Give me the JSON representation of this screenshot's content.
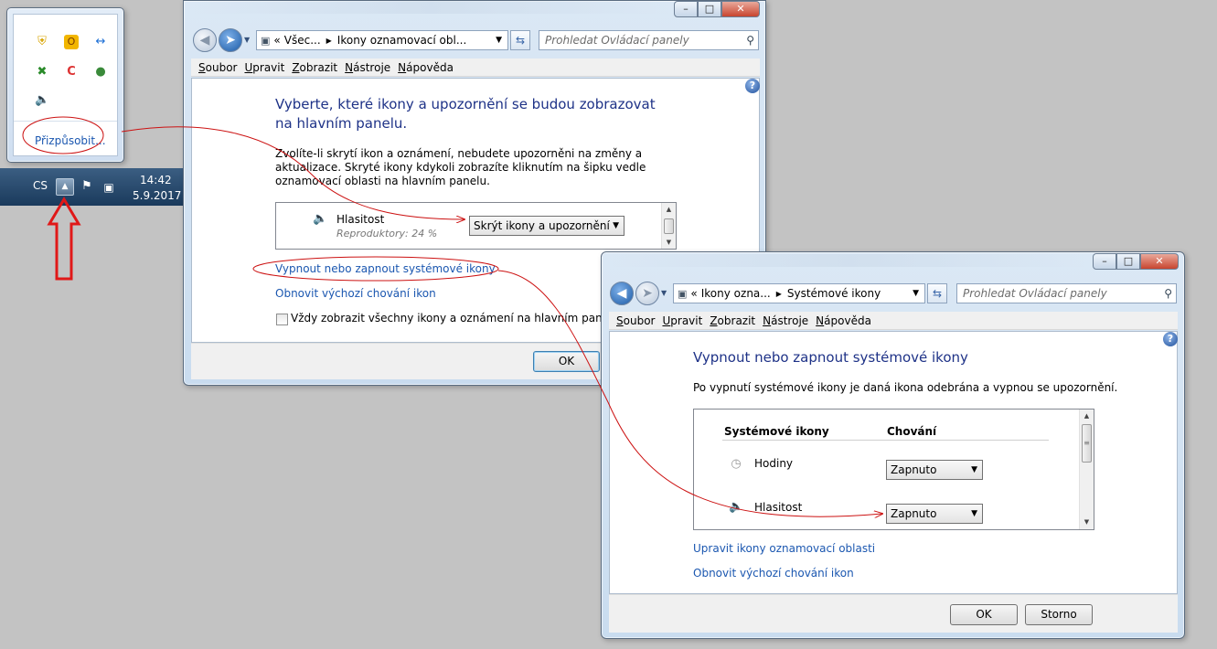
{
  "tray_popup": {
    "customize_link": "Přizpůsobit..."
  },
  "taskbar": {
    "language": "CS",
    "time": "14:42",
    "date": "5.9.2017"
  },
  "window1": {
    "address": {
      "prefix": "«",
      "crumb1": "Všec...",
      "crumb2": "Ikony oznamovací obl..."
    },
    "search_placeholder": "Prohledat Ovládací panely",
    "menu": [
      "Soubor",
      "Upravit",
      "Zobrazit",
      "Nástroje",
      "Nápověda"
    ],
    "heading": "Vyberte, které ikony a upozornění se budou zobrazovat na hlavním panelu.",
    "description": "Zvolíte-li skrytí ikon a oznámení, nebudete upozorněni na změny a aktualizace. Skryté ikony kdykoli zobrazíte kliknutím na šipku vedle oznamovací oblasti na hlavním panelu.",
    "list_item": {
      "name": "Hlasitost",
      "sub": "Reproduktory: 24 %",
      "behavior": "Skrýt ikony a upozornění"
    },
    "link_system_icons": "Vypnout nebo zapnout systémové ikony",
    "link_restore": "Obnovit výchozí chování ikon",
    "checkbox_always_show": "Vždy zobrazit všechny ikony a oznámení na hlavním panelu",
    "ok": "OK"
  },
  "window2": {
    "address": {
      "prefix": "«",
      "crumb1": "Ikony ozna...",
      "crumb2": "Systémové ikony"
    },
    "search_placeholder": "Prohledat Ovládací panely",
    "menu": [
      "Soubor",
      "Upravit",
      "Zobrazit",
      "Nástroje",
      "Nápověda"
    ],
    "heading": "Vypnout nebo zapnout systémové ikony",
    "description": "Po vypnutí systémové ikony je daná ikona odebrána a vypnou se upozornění.",
    "col_icons": "Systémové ikony",
    "col_behavior": "Chování",
    "rows": [
      {
        "name": "Hodiny",
        "behavior": "Zapnuto"
      },
      {
        "name": "Hlasitost",
        "behavior": "Zapnuto"
      }
    ],
    "link_edit": "Upravit ikony oznamovací oblasti",
    "link_restore": "Obnovit výchozí chování ikon",
    "ok": "OK",
    "cancel": "Storno"
  },
  "colors": {
    "link": "#1b57b0",
    "heading": "#1e3287",
    "annotation": "#cc1111",
    "taskbar": "#1a3a5c"
  }
}
